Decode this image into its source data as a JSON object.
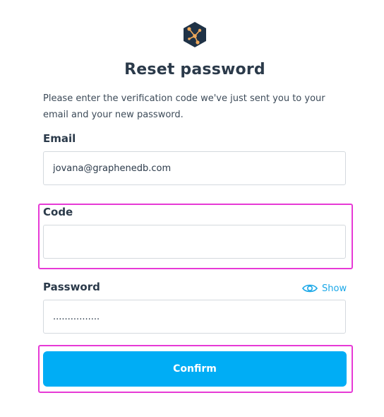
{
  "header": {
    "logo_icon": "graph-hexagon-logo",
    "title": "Reset password",
    "intro": "Please enter the verification code we've just sent you to your email and your new password."
  },
  "form": {
    "email": {
      "label": "Email",
      "value": "jovana@graphenedb.com"
    },
    "code": {
      "label": "Code",
      "value": ""
    },
    "password": {
      "label": "Password",
      "value": "................",
      "toggle_label": "Show",
      "toggle_icon": "eye-icon"
    },
    "confirm_label": "Confirm"
  },
  "colors": {
    "accent": "#00adf5",
    "link": "#1ba8e8",
    "highlight": "#e73ad6",
    "logo_bg": "#1f3246",
    "logo_nodes": "#f0a95a"
  }
}
